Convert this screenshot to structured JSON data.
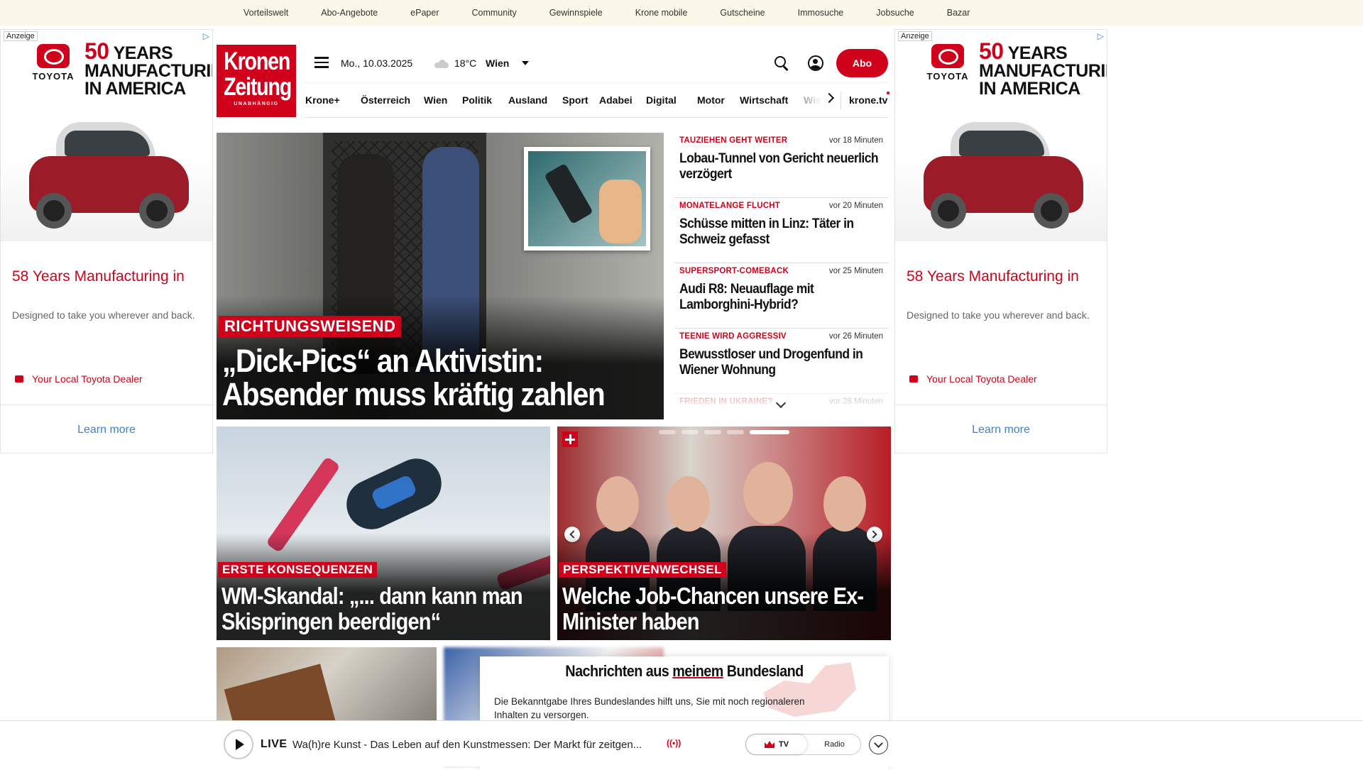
{
  "topbar": [
    "Vorteilswelt",
    "Abo-Angebote",
    "ePaper",
    "Community",
    "Gewinnspiele",
    "Krone mobile",
    "Gutscheine",
    "Immosuche",
    "Jobsuche",
    "Bazar"
  ],
  "ads": {
    "tag": "Anzeige",
    "brand": "TOYOTA",
    "headline_big": "50",
    "headline_rest1": "YEARS",
    "headline_rest2": "MANUFACTURING",
    "headline_rest3": "IN AMERICA",
    "title": "58 Years Manufacturing in",
    "description": "Designed to take you wherever and back.",
    "dealer": "Your Local Toyota Dealer",
    "cta": "Learn more",
    "brand_color": "#d0021b"
  },
  "header": {
    "logo_line1": "Kronen",
    "logo_line2": "Zeitung",
    "logo_line3": "UNABHÄNGIG",
    "date": "Mo., 10.03.2025",
    "temperature": "18°C",
    "city": "Wien",
    "abo_label": "Abo"
  },
  "nav": [
    "Krone+",
    "Österreich",
    "Wien",
    "Politik",
    "Ausland",
    "Sport",
    "Adabei",
    "Digital",
    "Motor",
    "Wirtschaft",
    "Wiss"
  ],
  "nav_tv": "krone.tv",
  "hero": {
    "kicker": "RICHTUNGSWEISEND",
    "title": "„Dick-Pics“ an Aktivistin: Absender muss kräftig zahlen"
  },
  "feed": [
    {
      "kicker": "TAUZIEHEN GEHT WEITER",
      "time": "vor 18 Minuten",
      "title": "Lobau-Tunnel von Gericht neuerlich verzögert"
    },
    {
      "kicker": "MONATELANGE FLUCHT",
      "time": "vor 20 Minuten",
      "title": "Schüsse mitten in Linz: Täter in Schweiz gefasst"
    },
    {
      "kicker": "SUPERSPORT-COMEBACK",
      "time": "vor 25 Minuten",
      "title": "Audi R8: Neuauflage mit Lamborghini-Hybrid?"
    },
    {
      "kicker": "TEENIE WIRD AGGRESSIV",
      "time": "vor 26 Minuten",
      "title": "Bewusstloser und Drogenfund in Wiener Wohnung"
    },
    {
      "kicker": "FRIEDEN IN UKRAINE?",
      "time": "vor 28 Minuten",
      "title": ""
    }
  ],
  "cards": [
    {
      "kicker": "ERSTE KONSEQUENZEN",
      "title": "WM-Skandal: „... dann kann man Skispringen beerdigen“"
    },
    {
      "kicker": "PERSPEKTIVENWECHSEL",
      "title": "Welche Job-Chancen unsere Ex-Minister haben"
    }
  ],
  "bundesland": {
    "title_pre": "Nachrichten aus ",
    "title_underlined": "meinem",
    "title_post": " Bundesland",
    "text": "Die Bekanntgabe Ihres Bundeslandes hilft uns, Sie mit noch regionaleren Inhalten zu versorgen."
  },
  "live": {
    "label": "LIVE",
    "text": "Wa(h)re Kunst - Das Leben auf den Kunstmessen: Der Markt für zeitgen...",
    "broadcast": "((•))",
    "tv": "TV",
    "radio": "Radio"
  }
}
